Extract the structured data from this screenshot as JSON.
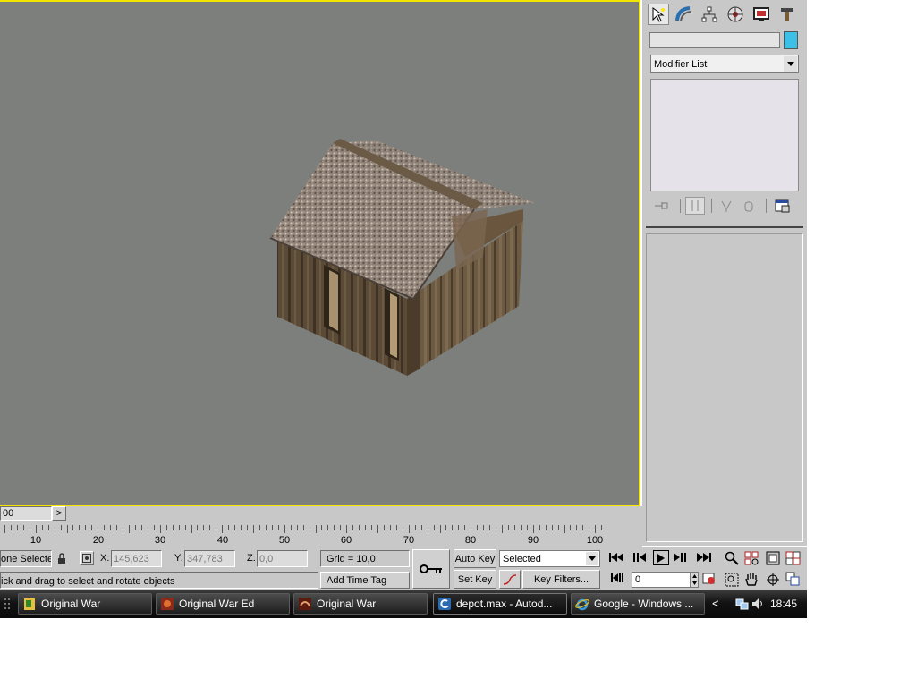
{
  "command_panel": {
    "tabs": [
      {
        "name": "create-tab-icon"
      },
      {
        "name": "modify-tab-icon"
      },
      {
        "name": "hierarchy-tab-icon"
      },
      {
        "name": "motion-tab-icon"
      },
      {
        "name": "display-tab-icon"
      },
      {
        "name": "utilities-tab-icon"
      }
    ],
    "object_name_value": "",
    "object_color": "#3cc0e8",
    "modifier_list_label": "Modifier List"
  },
  "timeline": {
    "frame_counter": "00",
    "next_arrow": ">",
    "ruler_labels": [
      "10",
      "20",
      "30",
      "40",
      "50",
      "60",
      "70",
      "80",
      "90",
      "100"
    ]
  },
  "status_bar": {
    "selection_text": "one Selecte",
    "x_label": "X:",
    "x_value": "145,623",
    "y_label": "Y:",
    "y_value": "347,783",
    "z_label": "Z:",
    "z_value": "0,0",
    "grid_text": "Grid = 10,0",
    "prompt_text": "ick and drag to select and rotate objects",
    "add_time_tag": "Add Time Tag",
    "auto_key": "Auto Key",
    "set_key": "Set Key",
    "selected_dropdown": "Selected",
    "key_filters": "Key Filters...",
    "current_frame": "0"
  },
  "taskbar": {
    "tasks": [
      {
        "label": "Original War"
      },
      {
        "label": "Original War Ed"
      },
      {
        "label": "Original War"
      },
      {
        "label": "depot.max - Autod..."
      },
      {
        "label": "Google - Windows ..."
      }
    ],
    "clock": "18:45",
    "tray_arrow": "<"
  }
}
